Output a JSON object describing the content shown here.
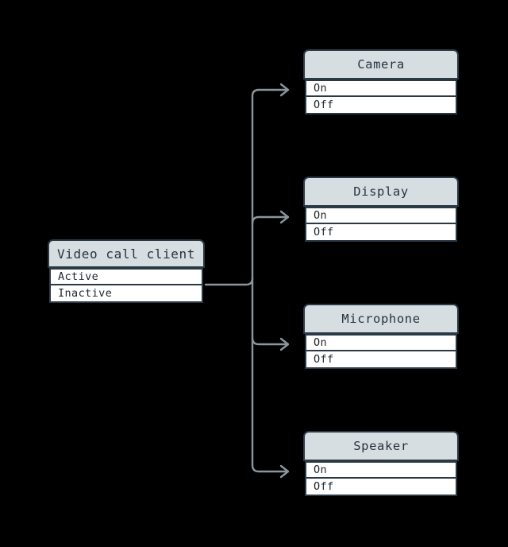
{
  "diagram": {
    "type": "state-diagram",
    "background_color": "#000000",
    "node_header_color": "#d7dee2",
    "node_body_color": "#ffffff",
    "node_border_color": "#2b3945",
    "edge_color": "#8b969c",
    "root": {
      "title": "Video call client",
      "states": [
        "Active",
        "Inactive"
      ]
    },
    "children": [
      {
        "title": "Camera",
        "states": [
          "On",
          "Off"
        ]
      },
      {
        "title": "Display",
        "states": [
          "On",
          "Off"
        ]
      },
      {
        "title": "Microphone",
        "states": [
          "On",
          "Off"
        ]
      },
      {
        "title": "Speaker",
        "states": [
          "On",
          "Off"
        ]
      }
    ],
    "edges": [
      {
        "from": "Video call client",
        "to": "Camera"
      },
      {
        "from": "Video call client",
        "to": "Display"
      },
      {
        "from": "Video call client",
        "to": "Microphone"
      },
      {
        "from": "Video call client",
        "to": "Speaker"
      }
    ]
  }
}
